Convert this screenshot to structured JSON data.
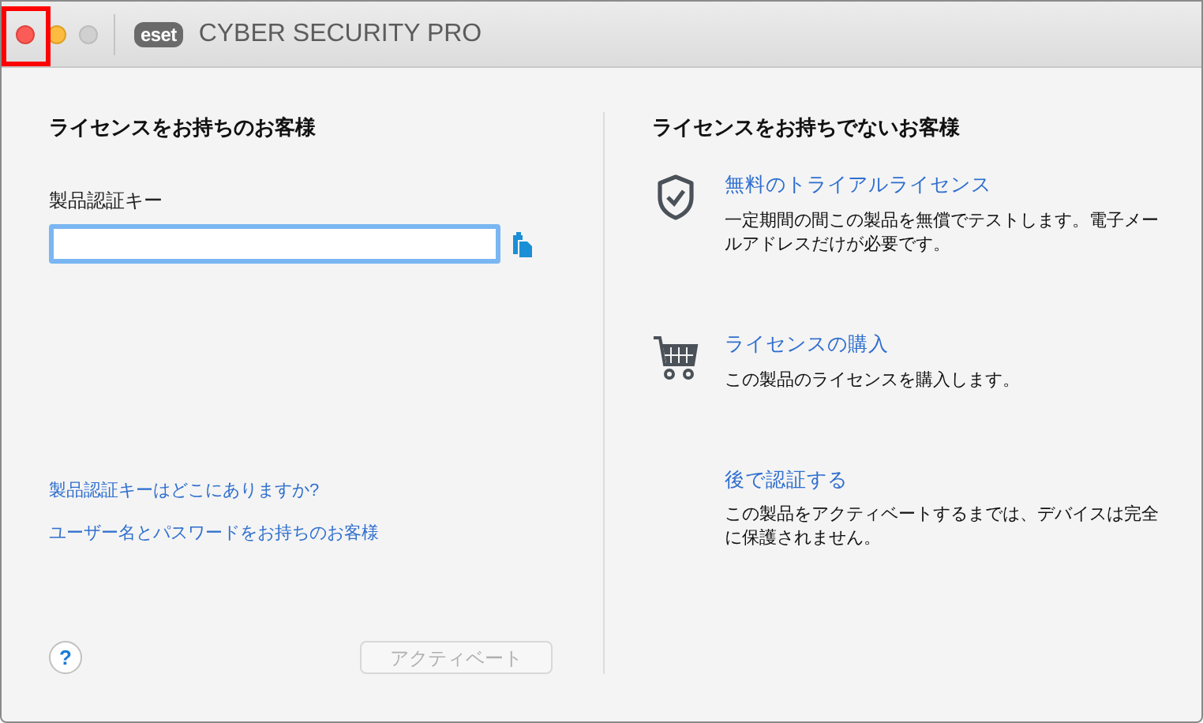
{
  "window": {
    "logo": "eset",
    "title": "CYBER SECURITY PRO",
    "controls": [
      {
        "kind": "close",
        "disabled": false
      },
      {
        "kind": "minimize",
        "disabled": false
      },
      {
        "kind": "zoom",
        "disabled": true
      }
    ]
  },
  "licensed": {
    "heading": "ライセンスをお持ちのお客様",
    "key_label": "製品認証キー",
    "key_field": {
      "focused": true
    },
    "links": [
      "製品認証キーはどこにありますか?",
      "ユーザー名とパスワードをお持ちのお客様"
    ],
    "help": "?",
    "activate": {
      "label": "アクティベート",
      "disabled": true
    }
  },
  "unlicensed": {
    "heading": "ライセンスをお持ちでないお客様",
    "options": [
      {
        "kind": "trial",
        "title": "無料のトライアルライセンス",
        "description": "一定期間の間この製品を無償でテストします。電子メールアドレスだけが必要です。"
      },
      {
        "kind": "buy",
        "title": "ライセンスの購入",
        "description": "この製品のライセンスを購入します。"
      },
      {
        "kind": "later",
        "title": "後で認証する",
        "description": "この製品をアクティベートするまでは、デバイスは完全に保護されません。"
      }
    ]
  }
}
